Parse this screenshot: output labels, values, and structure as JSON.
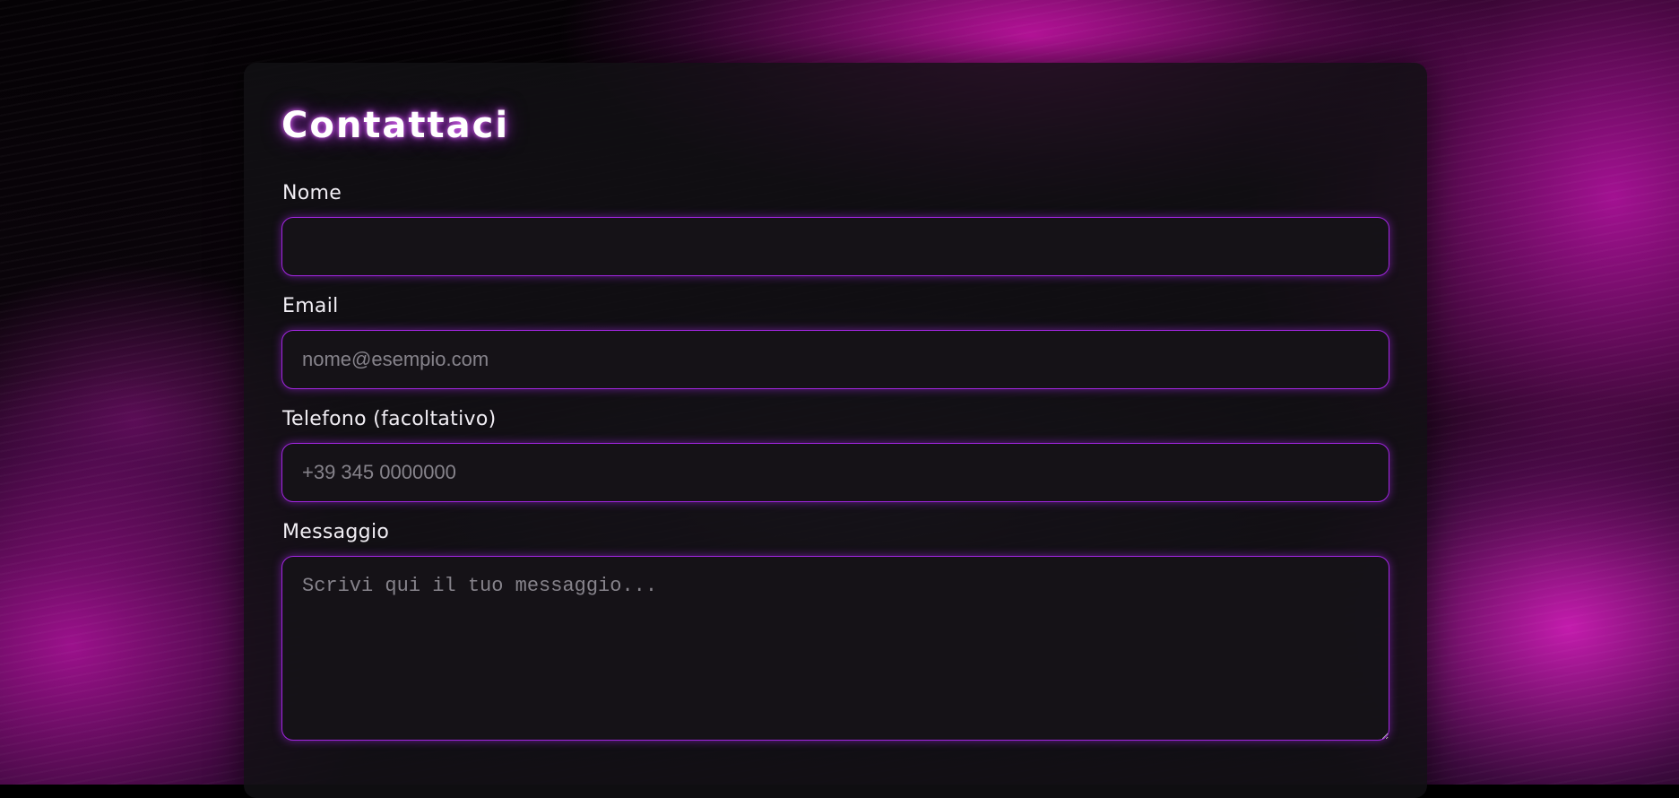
{
  "form": {
    "title": "Contattaci",
    "fields": {
      "name": {
        "label": "Nome",
        "value": "",
        "placeholder": ""
      },
      "email": {
        "label": "Email",
        "value": "",
        "placeholder": "nome@esempio.com"
      },
      "phone": {
        "label": "Telefono (facoltativo)",
        "value": "",
        "placeholder": "+39 345 0000000"
      },
      "message": {
        "label": "Messaggio",
        "value": "",
        "placeholder": "Scrivi qui il tuo messaggio..."
      }
    }
  },
  "theme": {
    "accent": "#a126e0",
    "background_glow": "#d616b4",
    "card_background": "#121014"
  }
}
